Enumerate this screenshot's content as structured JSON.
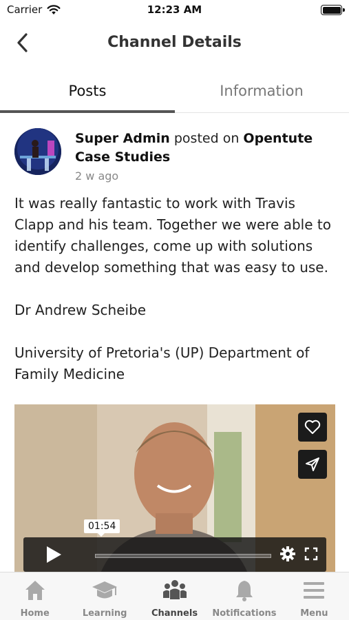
{
  "status_bar": {
    "carrier": "Carrier",
    "time": "12:23 AM"
  },
  "nav": {
    "title": "Channel Details"
  },
  "tabs": [
    {
      "label": "Posts",
      "active": true
    },
    {
      "label": "Information",
      "active": false
    }
  ],
  "post": {
    "author": "Super Admin",
    "action": "posted on",
    "channel": "Opentute Case Studies",
    "time": "2 w ago",
    "paragraphs": [
      "It was really fantastic to work with Travis Clapp and his team. Together we were able to identify challenges, come up with solutions and develop something that was easy to use.",
      "Dr Andrew Scheibe",
      "University of Pretoria's (UP) Department of Family Medicine"
    ],
    "video": {
      "seek_time": "01:54",
      "actions": {
        "like_icon": "heart-icon",
        "share_icon": "send-icon"
      }
    }
  },
  "tab_bar": [
    {
      "label": "Home",
      "icon": "home-icon",
      "active": false
    },
    {
      "label": "Learning",
      "icon": "graduation-cap-icon",
      "active": false
    },
    {
      "label": "Channels",
      "icon": "people-icon",
      "active": true
    },
    {
      "label": "Notifications",
      "icon": "bell-icon",
      "active": false
    },
    {
      "label": "Menu",
      "icon": "hamburger-icon",
      "active": false
    }
  ],
  "colors": {
    "tab_indicator": "#555555",
    "tab_inactive": "#777777",
    "active_tab_label": "#444444"
  }
}
